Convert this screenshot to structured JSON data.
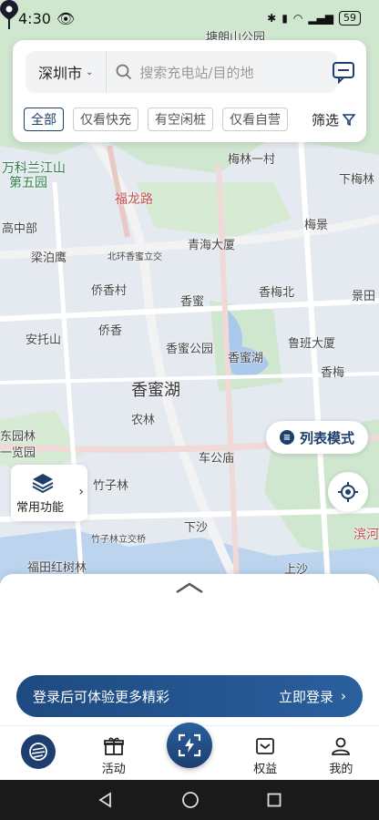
{
  "status_bar": {
    "time": "4:30",
    "battery": "59"
  },
  "search": {
    "city": "深圳市",
    "placeholder": "搜索充电站/目的地"
  },
  "filters": {
    "chips": [
      "全部",
      "仅看快充",
      "有空闲桩",
      "仅看自营"
    ],
    "filter_label": "筛选"
  },
  "map": {
    "labels": [
      "塘朗山公园",
      "梅林一村",
      "下梅林",
      "万科兰江山",
      "第五园",
      "福龙路",
      "高中部",
      "梁泊鹰",
      "北环香蜜立交",
      "青海大厦",
      "梅景",
      "侨香村",
      "香蜜",
      "香梅北",
      "景田",
      "安托山",
      "侨香",
      "香蜜公园",
      "香蜜湖",
      "鲁班大厦",
      "香蜜湖",
      "香梅",
      "农林",
      "车公庙",
      "东园林",
      "竹子林",
      "竹子林立交桥",
      "下沙",
      "上沙",
      "滨河",
      "福田红树林",
      "一览园"
    ]
  },
  "buttons": {
    "list_mode": "列表模式",
    "common_functions": "常用功能"
  },
  "login_banner": {
    "text": "登录后可体验更多精彩",
    "action": "立即登录"
  },
  "tabs": {
    "activity": "活动",
    "benefits": "权益",
    "mine": "我的"
  },
  "colors": {
    "brand": "#1c3f6e",
    "accent": "#2a5f9e"
  }
}
